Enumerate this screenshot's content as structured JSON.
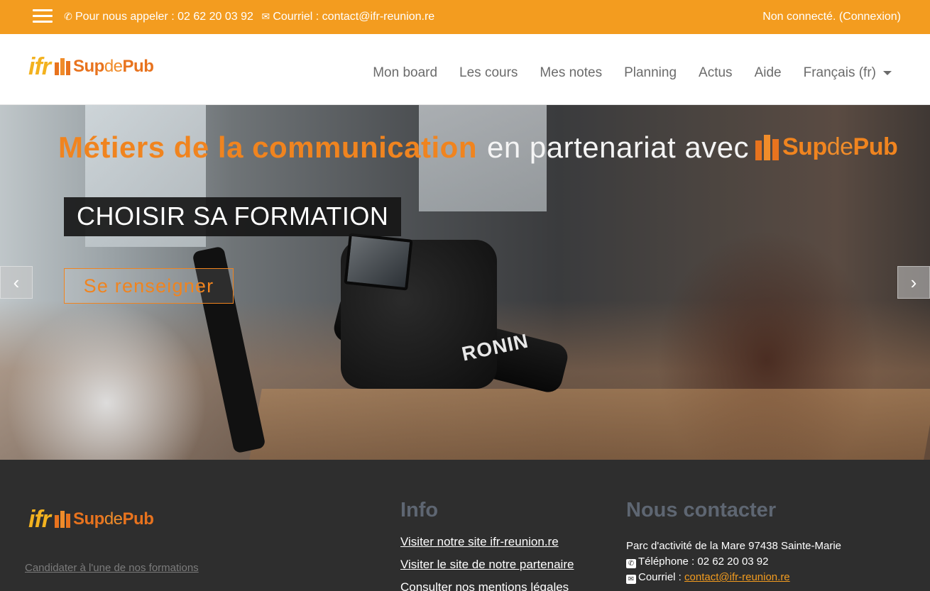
{
  "topbar": {
    "phone_text": "Pour nous appeler : 02 62 20 03 92",
    "email_text": "Courriel : contact@ifr-reunion.re",
    "login_status": "Non connecté.",
    "login_link": "(Connexion)"
  },
  "logo": {
    "ifr": "ifr",
    "sdp_sup": "Sup",
    "sdp_de": "de",
    "sdp_pub": "Pub"
  },
  "nav": {
    "items": [
      "Mon board",
      "Les cours",
      "Mes notes",
      "Planning",
      "Actus",
      "Aide"
    ],
    "language": "Français (fr)"
  },
  "hero": {
    "headline_orange": "Métiers de la communication",
    "headline_white": "en partenariat avec",
    "camera_label": "RONIN",
    "title": "CHOISIR SA FORMATION",
    "cta": "Se renseigner",
    "prev_arrow": "‹",
    "next_arrow": "›"
  },
  "footer": {
    "candidate_link": "Candidater à l'une de nos formations",
    "info_title": "Info",
    "info_links": [
      "Visiter notre site ifr-reunion.re",
      "Visiter le site de notre partenaire",
      "Consulter nos mentions légales"
    ],
    "contact_title": "Nous contacter",
    "address": "Parc d'activité de la Mare 97438 Sainte-Marie",
    "phone": "Téléphone : 02 62 20 03 92",
    "email_label": "Courriel :",
    "email": "contact@ifr-reunion.re"
  },
  "colors": {
    "accent_orange": "#f39c1f",
    "footer_bg": "#2e2e2e",
    "footer_heading": "#5e6672"
  }
}
